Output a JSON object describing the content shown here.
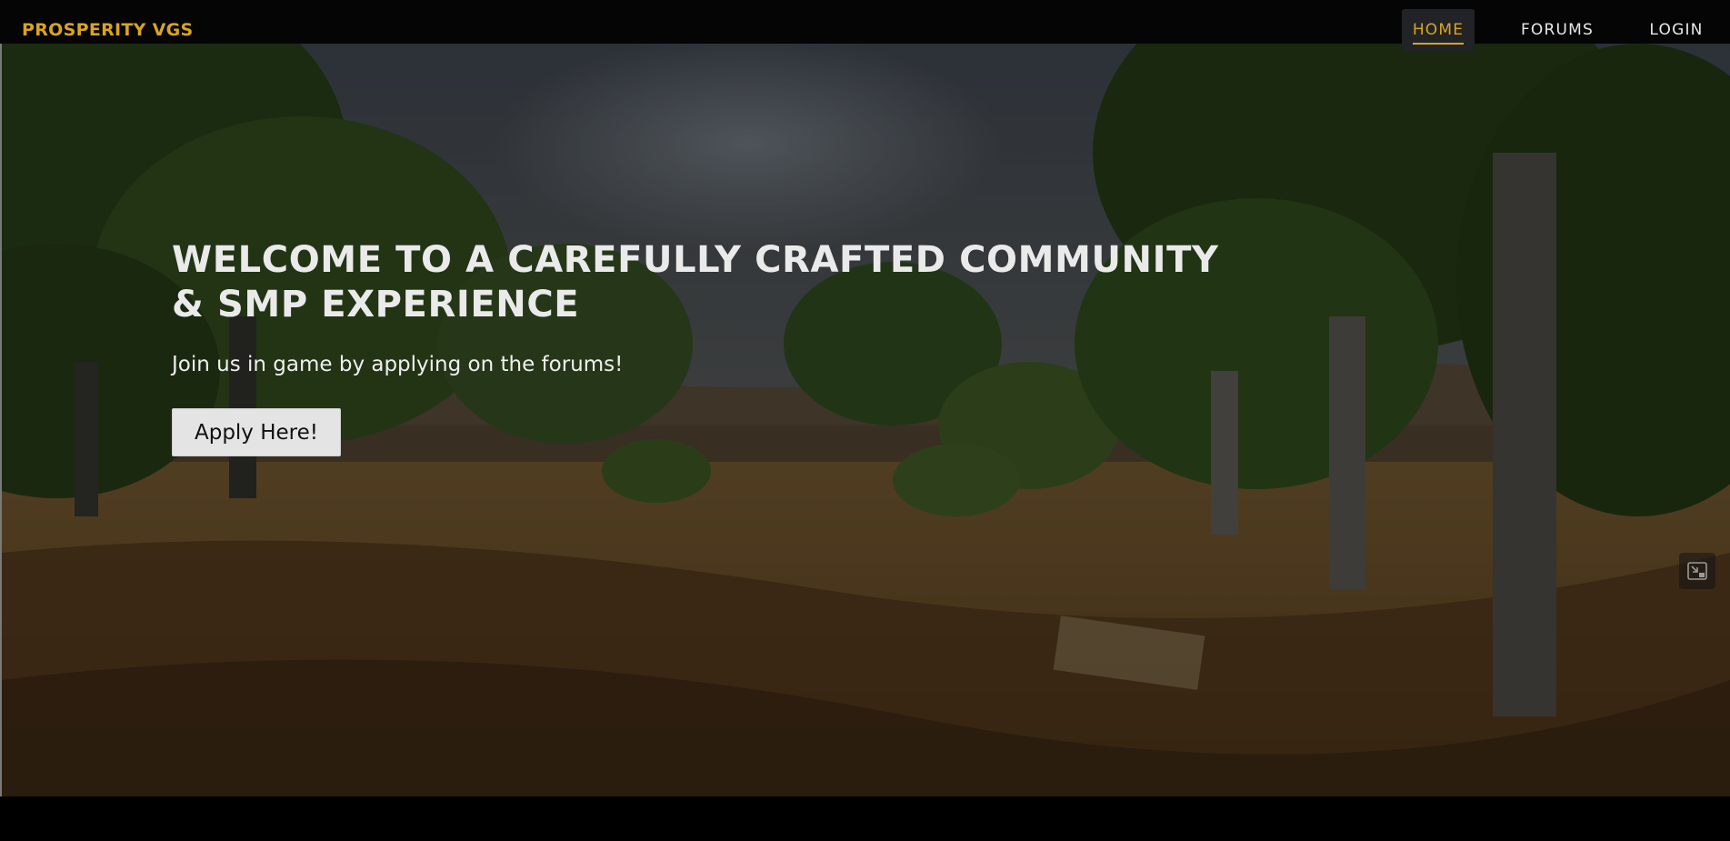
{
  "brand": {
    "name": "PROSPERITY VGS",
    "color": "#d9a520"
  },
  "nav": {
    "items": [
      {
        "label": "HOME",
        "active": true
      },
      {
        "label": "FORUMS",
        "active": false
      },
      {
        "label": "LOGIN",
        "active": false
      }
    ],
    "accent_color": "#d9a520"
  },
  "hero": {
    "title": "WELCOME TO A CAREFULLY CRAFTED COMMUNITY & SMP EXPERIENCE",
    "subtitle": "Join us in game by applying on the forums!",
    "cta_label": "Apply Here!",
    "corner_icon": "exit-fullscreen-icon"
  }
}
